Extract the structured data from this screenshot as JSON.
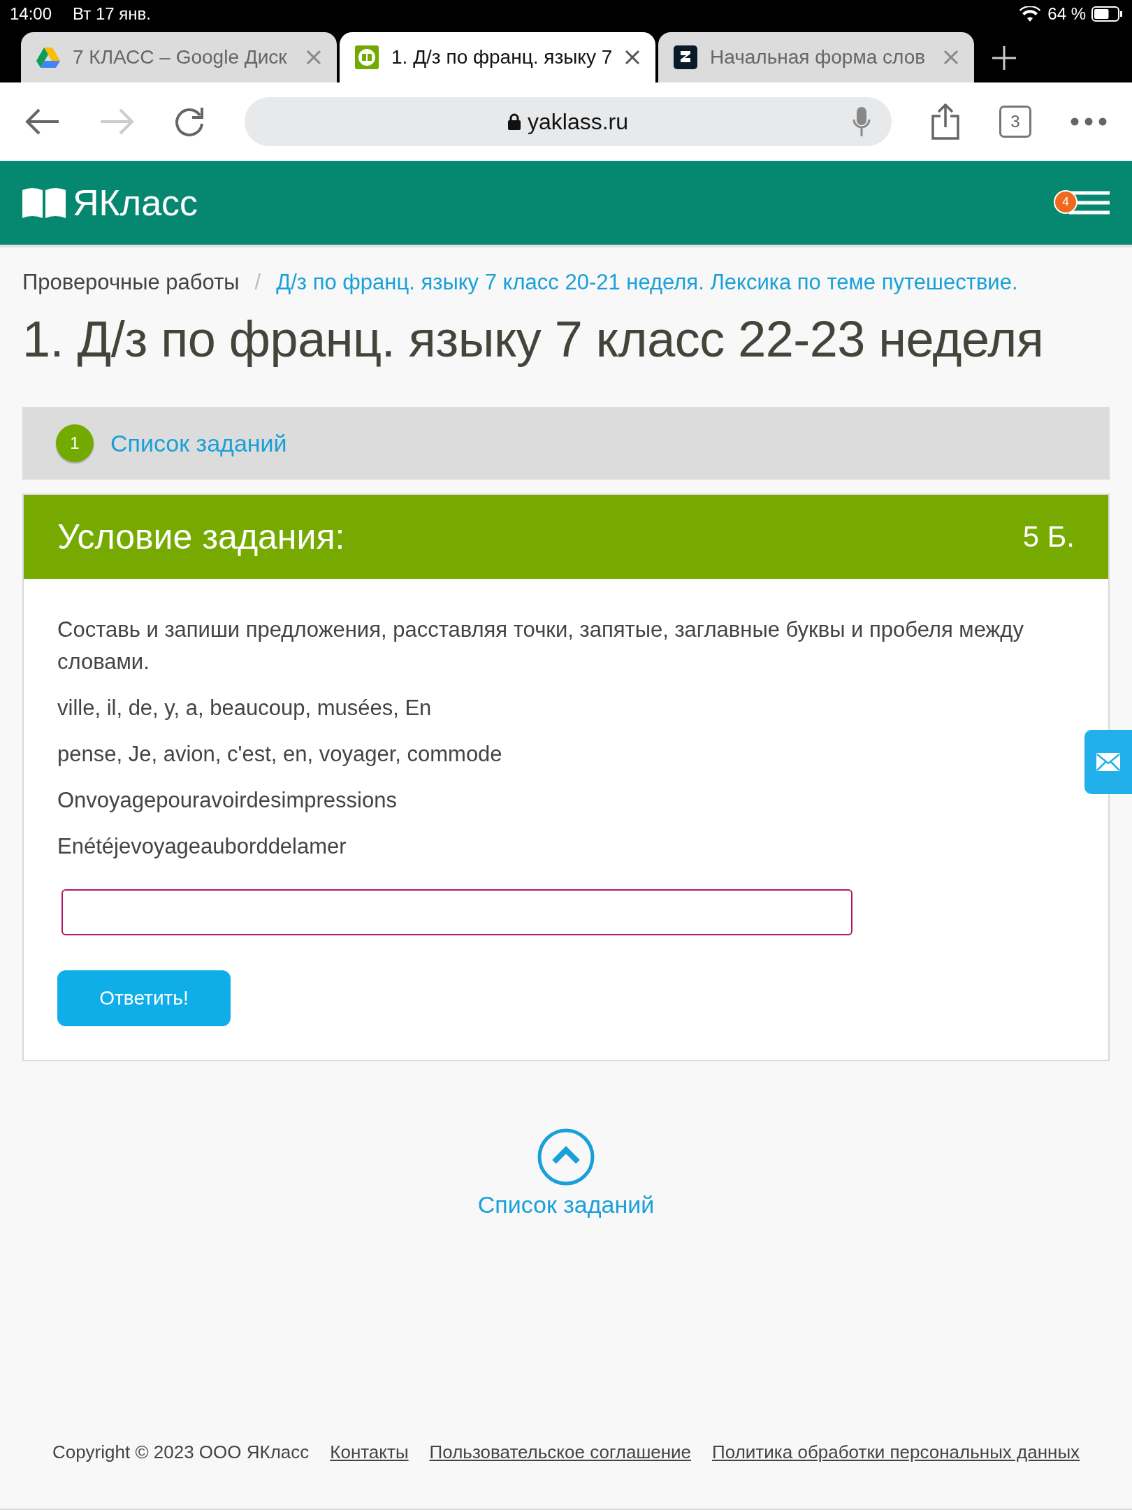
{
  "status_bar": {
    "time": "14:00",
    "date": "Вт 17 янв.",
    "battery": "64 %",
    "level": 0.64
  },
  "tabs": [
    {
      "kind": "drive",
      "title": "7 КЛАСС – Google Диск",
      "selected": false
    },
    {
      "kind": "yaklass",
      "title": "1. Д/з по франц. языку 7",
      "selected": true
    },
    {
      "kind": "z",
      "title": "Начальная форма слов",
      "selected": false
    }
  ],
  "address_bar": {
    "url": "yaklass.ru",
    "tab_count": "3"
  },
  "site_header": {
    "logo": "ЯКласс",
    "notifications": "4"
  },
  "breadcrumbs": [
    {
      "label": "Проверочные работы",
      "link": false
    },
    {
      "label": "Д/з по франц. языку 7 класс 20-21 неделя. Лексика по теме путешествие.",
      "link": true
    }
  ],
  "breadcrumb_separator": "/",
  "page_title": "1. Д/з по франц. языку 7 класс 22-23 неделя",
  "task_nav": {
    "number": "1",
    "label": "Список заданий"
  },
  "task": {
    "heading": "Условие задания:",
    "points": "5 Б.",
    "instruction": "Составь и запиши предложения, расставляя точки, запятые, заглавные буквы и пробеля между словами.",
    "lines": [
      "ville, il, de, y, a, beaucoup, musées, En",
      "pense, Je, avion, c'est, en, voyager, commode",
      "Onvoyagepouravoirdesimpressions",
      "Enétéjevoyageauborddelamer"
    ],
    "submit": "Ответить!"
  },
  "back_to_list": "Список заданий",
  "footer": {
    "copyright": "Copyright © 2023 ООО ЯКласс",
    "links": [
      "Контакты",
      "Пользовательское соглашение",
      "Политика обработки персональных данных"
    ]
  }
}
